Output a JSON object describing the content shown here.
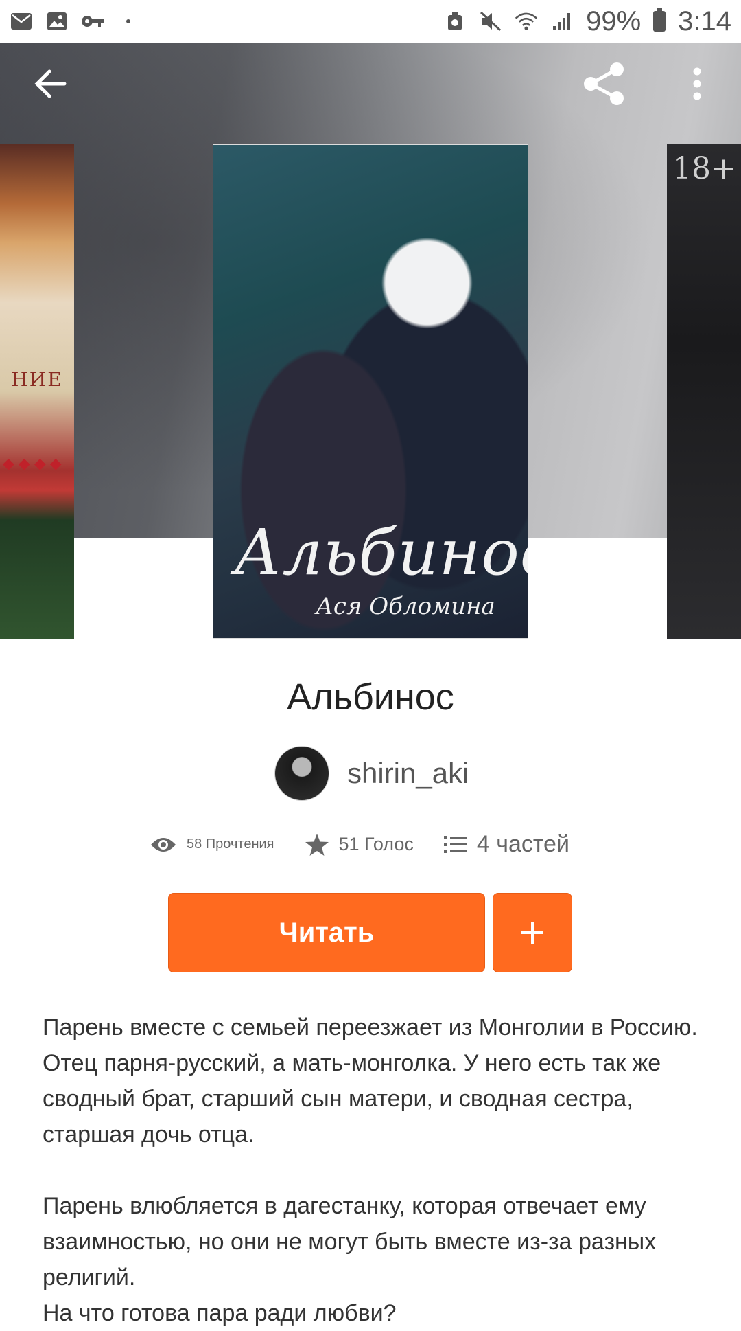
{
  "status_bar": {
    "icons_left": [
      "mail-icon",
      "image-icon",
      "key-icon",
      "dot-icon"
    ],
    "icons_right": [
      "dnd-icon",
      "mute-icon",
      "wifi-icon",
      "signal-icon",
      "battery-icon"
    ],
    "battery": "99%",
    "time": "3:14"
  },
  "toolbar": {
    "back_icon": "arrow-left-icon",
    "share_icon": "share-icon",
    "more_icon": "more-vertical-icon"
  },
  "covers": {
    "left_text": "НИЕ",
    "main_title": "Альбинос",
    "main_subtitle": "Ася Обломина",
    "right_age": "18+"
  },
  "book": {
    "title": "Альбинос",
    "author": "shirin_aki"
  },
  "stats": {
    "reads": "58 Прочтения",
    "votes": "51 Голос",
    "parts": "4 частей"
  },
  "actions": {
    "read_label": "Читать",
    "add_icon": "plus-icon"
  },
  "description": {
    "p1": "Парень вместе с семьей переезжает из Монголии в Россию. Отец парня-русский, а мать-монголка. У него есть так же сводный брат, старший сын матери, и сводная сестра, старшая дочь отца.",
    "p2": "Парень влюбляется в дагестанку, которая отвечает ему взаимностью, но они не могут быть вместе из-за разных религий.",
    "p3": "На что готова пара ради любви?"
  },
  "colors": {
    "accent": "#ff6a1f",
    "text": "#222222",
    "muted": "#666666"
  }
}
